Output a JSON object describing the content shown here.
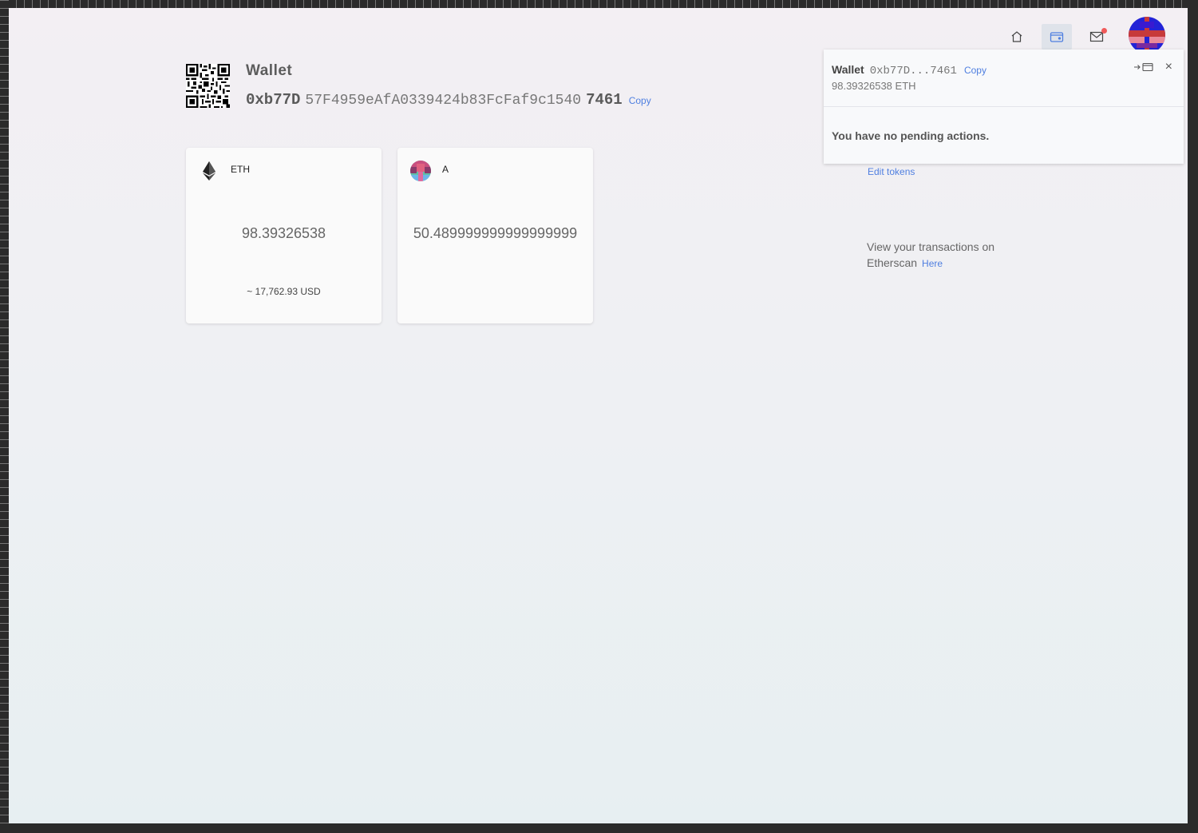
{
  "wallet": {
    "title": "Wallet",
    "address_head": "0xb77D",
    "address_middle": "57F4959eAfA0339424b83FcFaf9c1540",
    "address_tail": "7461",
    "copy_label": "Copy"
  },
  "tokens": [
    {
      "symbol": "ETH",
      "icon": "ethereum-icon",
      "balance": "98.39326538",
      "usd": "~ 17,762.93 USD"
    },
    {
      "symbol": "A",
      "icon": "token-identicon",
      "balance": "50.489999999999999999",
      "usd": ""
    }
  ],
  "sidebar": {
    "edit_tokens": "Edit tokens",
    "etherscan_text": "View your transactions on Etherscan",
    "etherscan_link": "Here"
  },
  "nav": {
    "home_icon": "home-icon",
    "wallet_icon": "wallet-icon",
    "mail_icon": "mail-icon",
    "has_notification": true
  },
  "popover": {
    "title": "Wallet",
    "address_short": "0xb77D...7461",
    "copy_label": "Copy",
    "balance": "98.39326538 ETH",
    "empty_message": "You have no pending actions.",
    "close_label": "×"
  },
  "colors": {
    "accent": "#4f7fe0",
    "notification": "#f05a5a",
    "nav_active_bg": "#dfe3ea"
  }
}
